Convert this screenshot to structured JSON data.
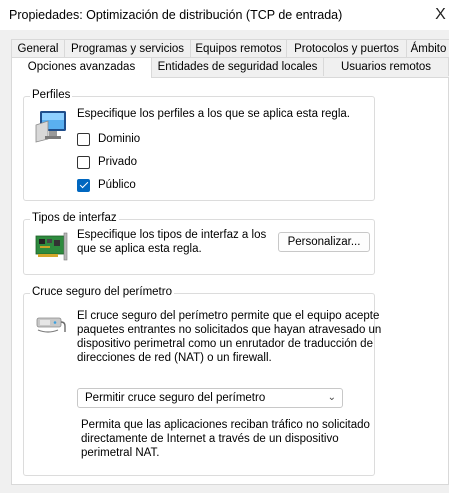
{
  "window": {
    "title": "Propiedades: Optimización de distribución (TCP de entrada)",
    "close_glyph": "X"
  },
  "tabs": {
    "row1": [
      "General",
      "Programas y servicios",
      "Equipos remotos",
      "Protocolos y puertos",
      "Ámbito"
    ],
    "row2": [
      "Opciones avanzadas",
      "Entidades de seguridad locales",
      "Usuarios remotos"
    ],
    "active": "Opciones avanzadas"
  },
  "profiles": {
    "legend": "Perfiles",
    "description": "Especifique los perfiles a los que se aplica esta regla.",
    "icon": "computer-monitor-icon",
    "items": [
      {
        "label": "Dominio",
        "checked": false
      },
      {
        "label": "Privado",
        "checked": false
      },
      {
        "label": "Público",
        "checked": true
      }
    ]
  },
  "interfaces": {
    "legend": "Tipos de interfaz",
    "line1": "Especifique los tipos de interfaz a los",
    "line2": "que se aplica esta regla.",
    "icon": "network-card-icon",
    "customize_label": "Personalizar..."
  },
  "edge": {
    "legend": "Cruce seguro del perímetro",
    "icon": "edge-traversal-icon",
    "desc_lines": [
      "El cruce seguro del perímetro permite que el equipo acepte",
      "paquetes entrantes no solicitados que hayan atravesado un",
      "dispositivo perimetral como un enrutador de traducción de",
      "direcciones de red (NAT) o un firewall."
    ],
    "select_value": "Permitir cruce seguro del perímetro",
    "help_lines": [
      "Permita que las aplicaciones reciban tráfico no solicitado",
      "directamente de Internet a través de un dispositivo",
      "perimetral NAT."
    ]
  },
  "colors": {
    "accent": "#0067c0",
    "dialog_bg": "#f0f0f0",
    "panel_bg": "#ffffff"
  }
}
